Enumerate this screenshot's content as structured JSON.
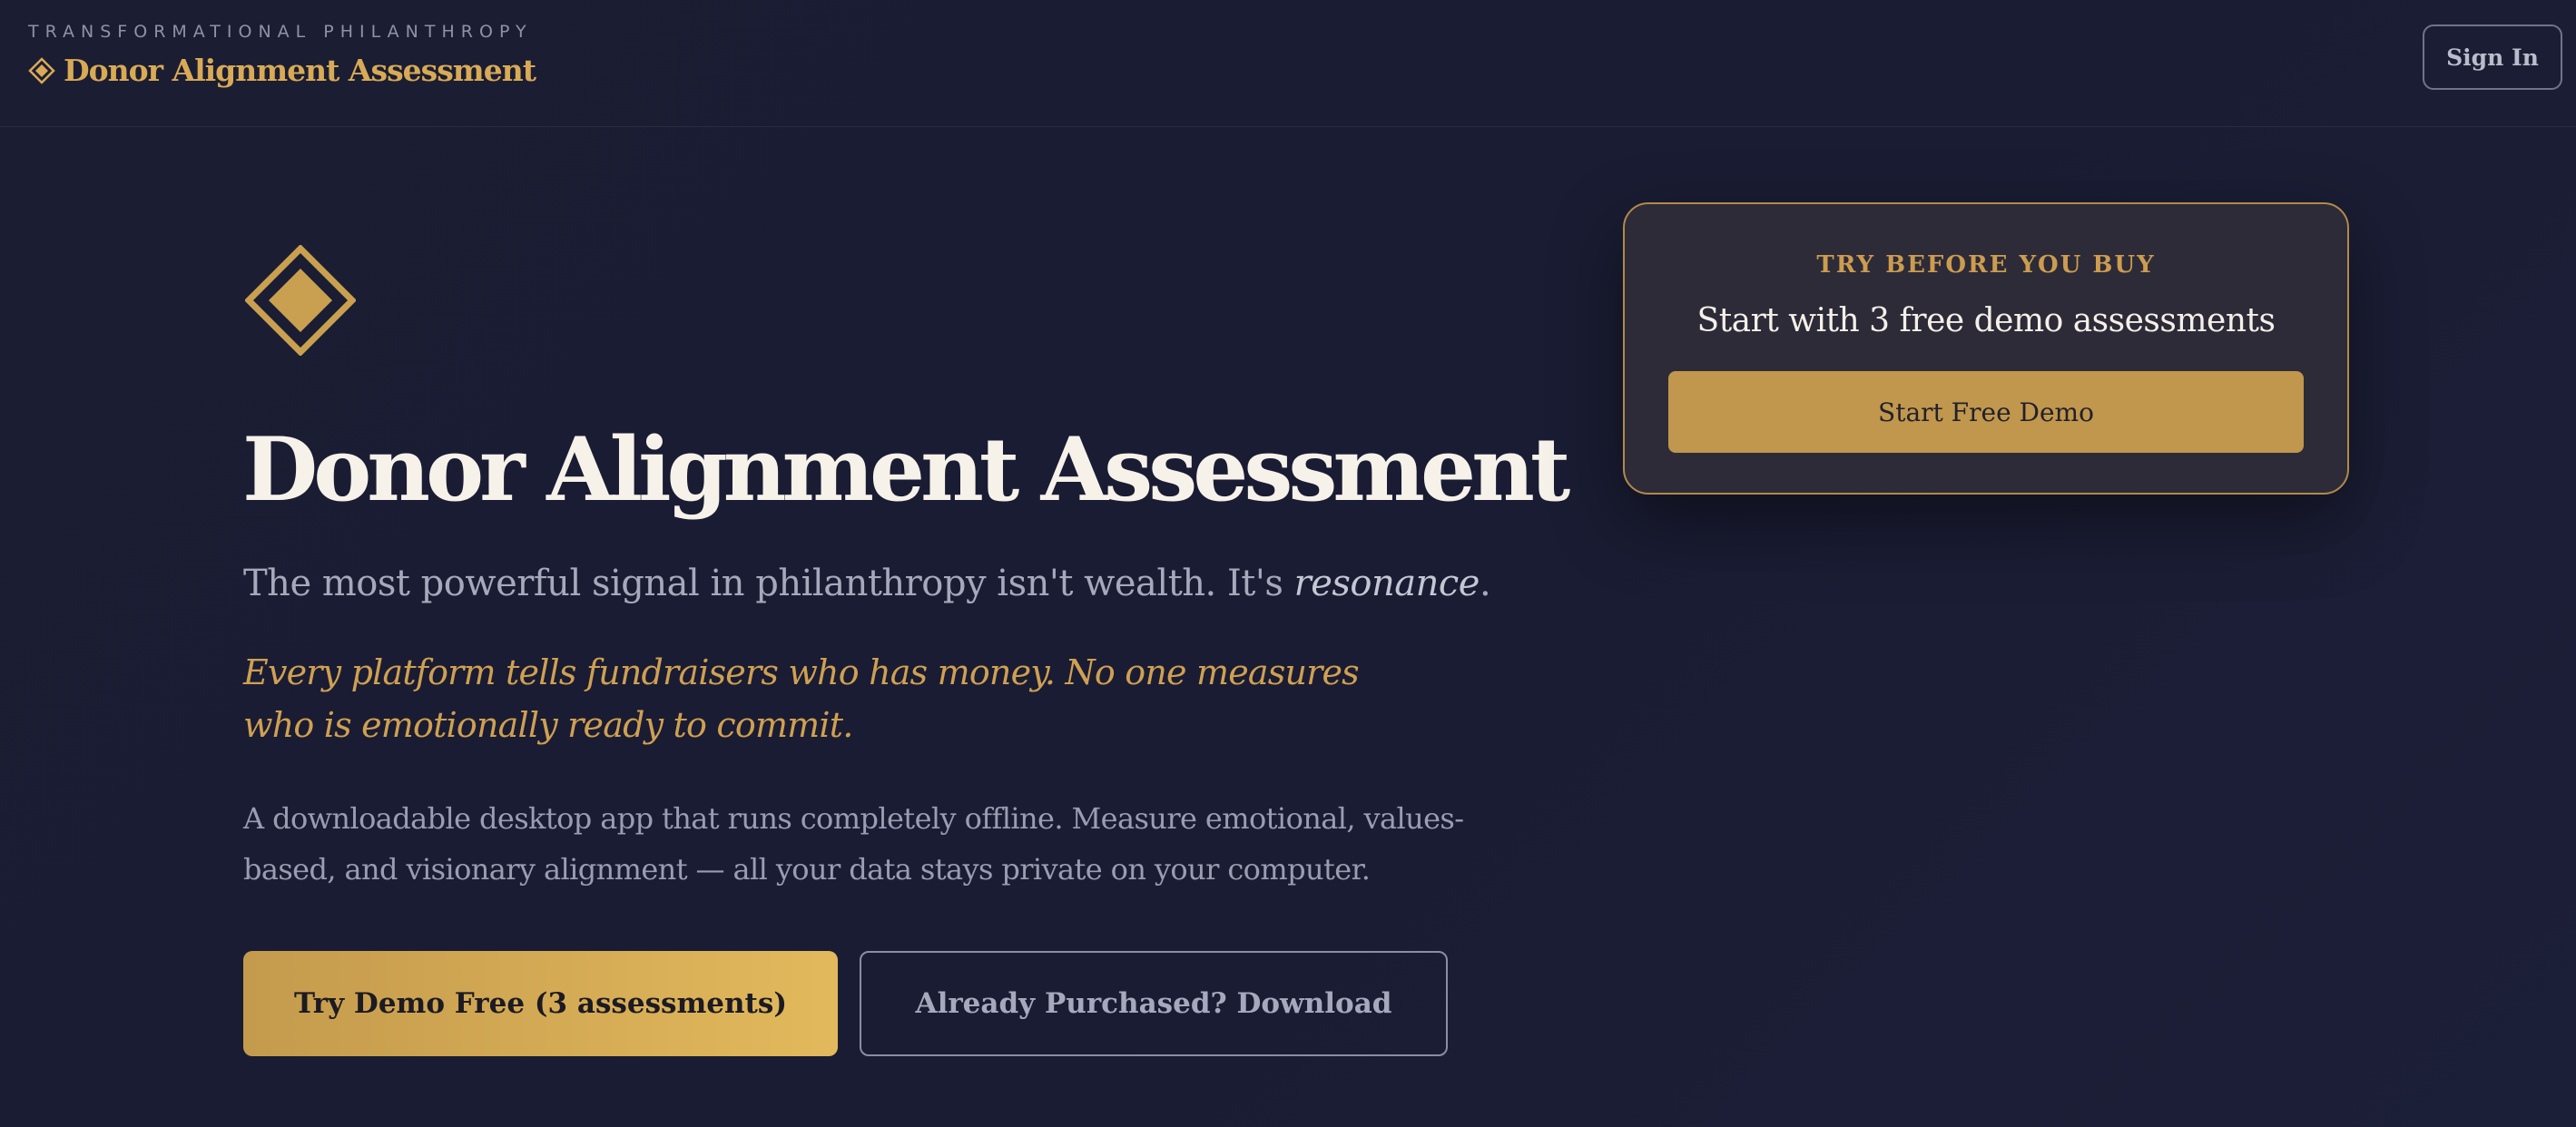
{
  "header": {
    "tagline": "TRANSFORMATIONAL PHILANTHROPY",
    "brand_name": "Donor Alignment Assessment",
    "brand_icon": "diamond-icon",
    "sign_in_label": "Sign In"
  },
  "hero": {
    "logo_icon": "diamond-logo-icon",
    "title": "Donor Alignment Assessment",
    "subtitle_prefix": "The most powerful signal in philanthropy isn't wealth. It's ",
    "subtitle_emphasis": "resonance",
    "subtitle_suffix": ".",
    "quote": "Every platform tells fundraisers who has money. No one measures who is emotionally ready to commit.",
    "description": "A downloadable desktop app that runs completely offline. Measure emotional, values-based, and visionary alignment — all your data stays private on your computer.",
    "primary_cta": "Try Demo Free (3 assessments)",
    "secondary_cta": "Already Purchased? Download"
  },
  "demo_card": {
    "eyebrow": "TRY BEFORE YOU BUY",
    "heading": "Start with 3 free demo assessments",
    "button_label": "Start Free Demo"
  },
  "colors": {
    "background": "#1b1d33",
    "gold": "#d8aa55",
    "card_background": "#2d2b38",
    "text_light": "#f6f2ea",
    "text_muted": "#9a9db2"
  }
}
